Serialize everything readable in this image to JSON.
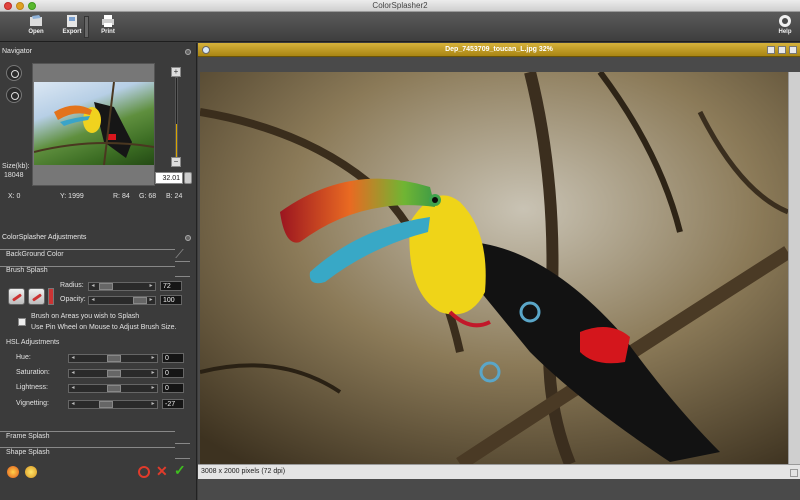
{
  "window": {
    "title": "ColorSplasher2"
  },
  "toolbar": {
    "open": "Open",
    "export": "Export",
    "print": "Print",
    "help": "Help"
  },
  "navigator": {
    "title": "Navigator",
    "size_label": "Size(kb):",
    "size_value": "18048",
    "zoom_value": "32.01",
    "zoom_level": 0.48,
    "x": "X: 0",
    "y": "Y: 1999",
    "r": "R: 84",
    "g": "G: 68",
    "b": "B: 24"
  },
  "adjustments": {
    "title": "ColorSplasher Adjustments",
    "background_color": "BackGround Color",
    "brush_splash": {
      "title": "Brush Splash",
      "radius_label": "Radius:",
      "radius_value": "72",
      "opacity_label": "Opacity:",
      "opacity_value": "100",
      "hint1": "Brush on Areas you wish to Splash",
      "hint2": "Use Pin Wheel on Mouse to Adjust Brush Size."
    },
    "hsl": {
      "title": "HSL Adjustments",
      "hue_label": "Hue:",
      "hue_value": "0",
      "saturation_label": "Saturation:",
      "saturation_value": "0",
      "lightness_label": "Lightness:",
      "lightness_value": "0",
      "vignetting_label": "Vignetting:",
      "vignetting_value": "-27"
    },
    "frame_splash": "Frame Splash",
    "shape_splash": "Shape Splash"
  },
  "image_window": {
    "title": "Dep_7453709_toucan_L.jpg 32%",
    "status": "3008 x 2000 pixels (72 dpi)"
  },
  "colors": {
    "accent": "#c9a20f",
    "panel": "#3b3b3b",
    "ok": "#3fbf1f",
    "cancel": "#e03b2b"
  }
}
